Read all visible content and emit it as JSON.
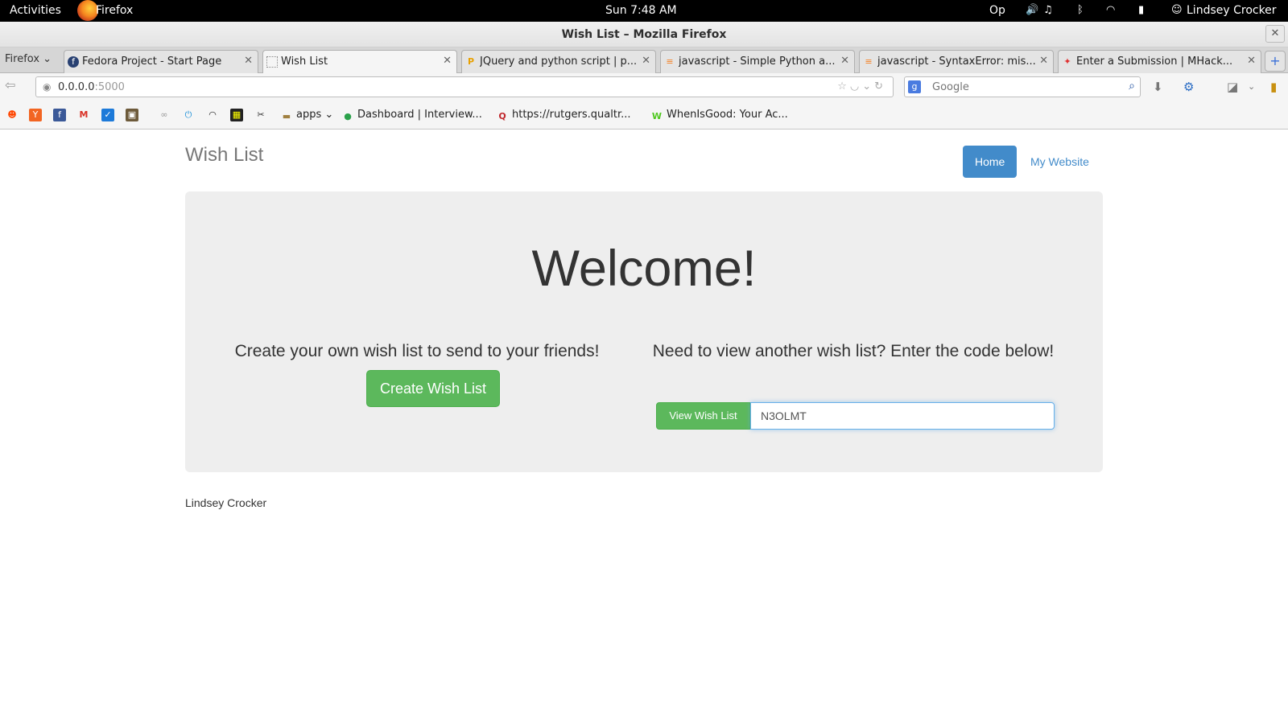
{
  "topbar": {
    "activities": "Activities",
    "app_name": "Firefox",
    "clock": "Sun  7:48 AM",
    "op_label": "Op",
    "user": "Lindsey Crocker"
  },
  "window": {
    "title": "Wish List – Mozilla Firefox"
  },
  "tabs": {
    "menu_label": "Firefox",
    "items": [
      {
        "label": "Fedora Project - Start Page",
        "icon": "fedora-icon"
      },
      {
        "label": "Wish List",
        "icon": "blank-page-icon"
      },
      {
        "label": "JQuery and python script | p...",
        "icon": "pb-icon"
      },
      {
        "label": "javascript - Simple Python a...",
        "icon": "stackoverflow-icon"
      },
      {
        "label": "javascript - SyntaxError: mis...",
        "icon": "stackoverflow-icon"
      },
      {
        "label": "Enter a Submission | MHack...",
        "icon": "puzzle-icon"
      }
    ]
  },
  "navbar": {
    "url_host": "0.0.0.0",
    "url_port": ":5000",
    "search_placeholder": "Google"
  },
  "bookmarks": {
    "folder_label": "apps",
    "items": [
      {
        "label": "Dashboard | Interview...",
        "icon": "interview-icon"
      },
      {
        "label": "https://rutgers.qualtr...",
        "icon": "qualtrics-icon"
      },
      {
        "label": "WhenIsGood: Your Ac...",
        "icon": "wheningood-icon"
      }
    ]
  },
  "page": {
    "brand": "Wish List",
    "nav_home": "Home",
    "nav_website": "My Website",
    "welcome": "Welcome!",
    "left_text": "Create your own wish list to send to your friends!",
    "create_button": "Create Wish List",
    "right_text": "Need to view another wish list? Enter the code below!",
    "view_button": "View Wish List",
    "code_value": "N3OLMT",
    "footer": "Lindsey Crocker"
  },
  "colors": {
    "primary": "#428bca",
    "success": "#5cb85c",
    "jumbotron": "#eeeeee"
  }
}
